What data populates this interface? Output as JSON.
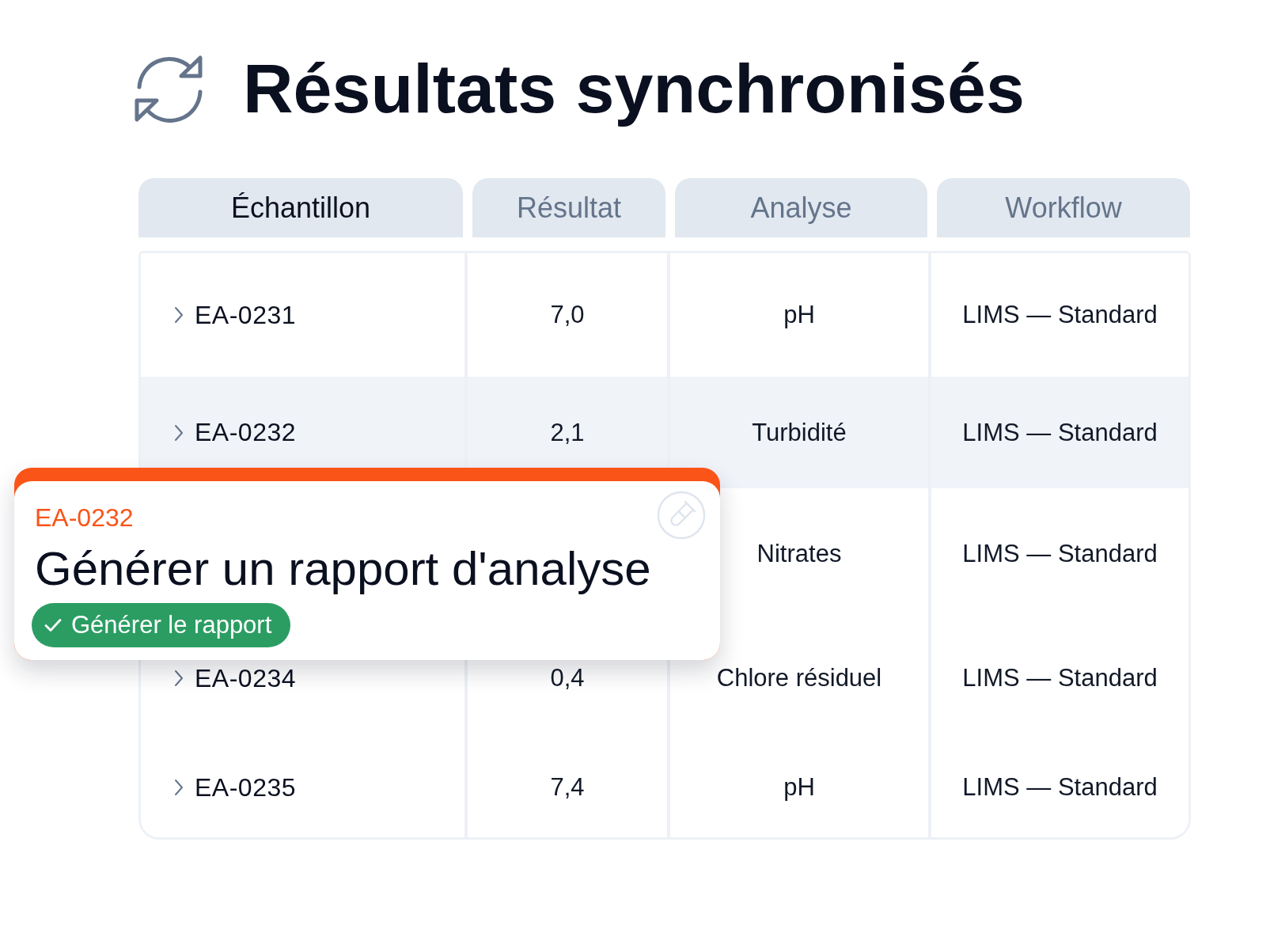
{
  "title": {
    "text": "Résultats synchronisés"
  },
  "table": {
    "columns": [
      {
        "label": "Échantillon",
        "selected": true
      },
      {
        "label": "Résultat",
        "selected": false
      },
      {
        "label": "Analyse",
        "selected": false
      },
      {
        "label": "Workflow",
        "selected": false
      }
    ],
    "rows": [
      {
        "sample": "EA-0231",
        "result": "7,0",
        "analysis": "pH",
        "workflow": "LIMS — Standard",
        "selected": false
      },
      {
        "sample": "EA-0232",
        "result": "2,1",
        "analysis": "Turbidité",
        "workflow": "LIMS — Standard",
        "selected": true
      },
      {
        "analysis": "Nitrates",
        "workflow": "LIMS — Standard",
        "selected": false
      },
      {
        "sample": "EA-0234",
        "result": "0,4",
        "analysis": "Chlore résiduel",
        "workflow": "LIMS — Standard",
        "selected": false
      },
      {
        "sample": "EA-0235",
        "result": "7,4",
        "analysis": "pH",
        "workflow": "LIMS — Standard",
        "selected": false
      }
    ]
  },
  "popup": {
    "sample_id": "EA-0232",
    "title": "Générer un rapport d'analyse",
    "button": "Générer le rapport"
  }
}
